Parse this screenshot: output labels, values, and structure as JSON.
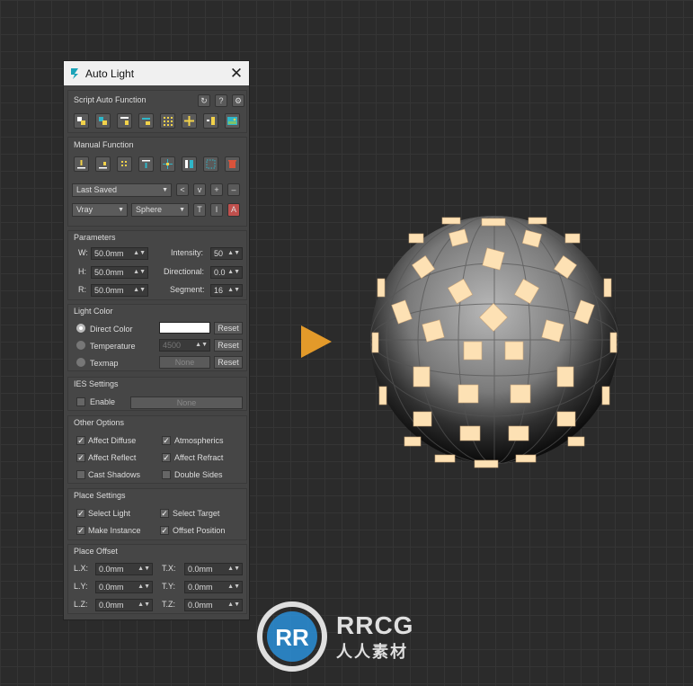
{
  "window": {
    "title": "Auto Light",
    "close_icon": "close-icon"
  },
  "script_auto": {
    "label": "Script Auto Function",
    "icons": [
      "refresh-icon",
      "help-icon",
      "settings-icon"
    ]
  },
  "manual": {
    "label": "Manual Function",
    "preset": "Last Saved",
    "nav": [
      "<",
      "v",
      "+",
      "–"
    ],
    "renderer": "Vray",
    "shape": "Sphere",
    "mode_buttons": [
      "T",
      "I",
      "A"
    ]
  },
  "parameters": {
    "label": "Parameters",
    "w_label": "W:",
    "w": "50.0mm",
    "h_label": "H:",
    "h": "50.0mm",
    "r_label": "R:",
    "r": "50.0mm",
    "intensity_label": "Intensity:",
    "intensity": "50",
    "directional_label": "Directional:",
    "directional": "0.0",
    "segment_label": "Segment:",
    "segment": "16"
  },
  "light_color": {
    "label": "Light Color",
    "direct_color": "Direct Color",
    "temperature": "Temperature",
    "temperature_value": "4500",
    "texmap": "Texmap",
    "texmap_value": "None",
    "reset": "Reset",
    "swatch": "#ffffff"
  },
  "ies": {
    "label": "IES Settings",
    "enable": "Enable",
    "value": "None"
  },
  "other": {
    "label": "Other Options",
    "affect_diffuse": "Affect Diffuse",
    "atmospherics": "Atmospherics",
    "affect_reflect": "Affect Reflect",
    "affect_refract": "Affect Refract",
    "cast_shadows": "Cast Shadows",
    "double_sides": "Double Sides"
  },
  "place": {
    "label": "Place Settings",
    "select_light": "Select Light",
    "select_target": "Select Target",
    "make_instance": "Make Instance",
    "offset_position": "Offset Position"
  },
  "offset": {
    "label": "Place Offset",
    "lx_label": "L.X:",
    "lx": "0.0mm",
    "ly_label": "L.Y:",
    "ly": "0.0mm",
    "lz_label": "L.Z:",
    "lz": "0.0mm",
    "tx_label": "T.X:",
    "tx": "0.0mm",
    "ty_label": "T.Y:",
    "ty": "0.0mm",
    "tz_label": "T.Z:",
    "tz": "0.0mm"
  },
  "watermark": {
    "brand": "RRCG",
    "subtitle": "人人素材"
  },
  "colors": {
    "accent": "#e39a2a",
    "panel": "#444444",
    "active_red": "#c0504d"
  }
}
